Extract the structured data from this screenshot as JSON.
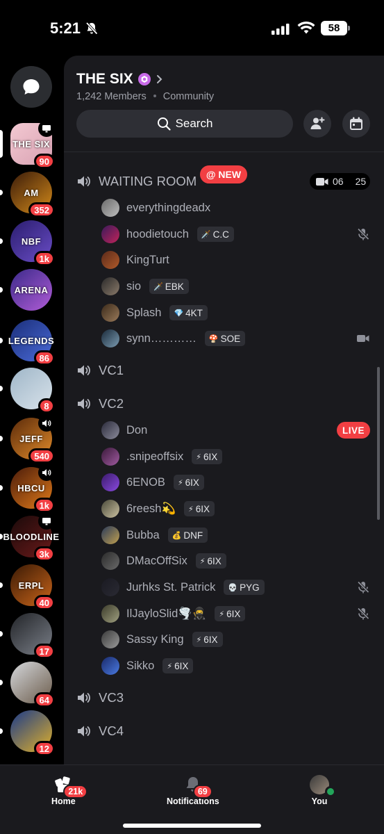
{
  "status_bar": {
    "time": "5:21",
    "battery": "58"
  },
  "rail": {
    "servers": [
      {
        "name": "the-six",
        "label": "THE SIX",
        "badge": "90",
        "colors": [
          "#f3c9d2",
          "#d9a2b3"
        ],
        "corner": "screen",
        "selected": true
      },
      {
        "name": "arboit-madden",
        "label": "AM",
        "badge": "352",
        "colors": [
          "#3a1b0a",
          "#d38a1a"
        ]
      },
      {
        "name": "nbf-league",
        "label": "NBF",
        "badge": "1k",
        "colors": [
          "#2a1d6e",
          "#6a4dc6"
        ]
      },
      {
        "name": "arena",
        "label": "ARENA",
        "badge": "",
        "colors": [
          "#3b2a8a",
          "#b05cd6"
        ]
      },
      {
        "name": "legends",
        "label": "LEGENDS",
        "badge": "86",
        "colors": [
          "#1b2f7a",
          "#4a6ad8"
        ]
      },
      {
        "name": "cartoon-server",
        "label": "",
        "badge": "8",
        "colors": [
          "#9fb6c8",
          "#d8e2ea"
        ]
      },
      {
        "name": "jeff-chat",
        "label": "JEFF",
        "badge": "540",
        "colors": [
          "#5a2a0a",
          "#e08a2a"
        ],
        "corner": "speaker"
      },
      {
        "name": "aur-hbcu",
        "label": "HBCU",
        "badge": "1k",
        "colors": [
          "#4a1b0a",
          "#e07a1a"
        ],
        "corner": "speaker"
      },
      {
        "name": "bloodline",
        "label": "BLOODLINE",
        "badge": "3k",
        "colors": [
          "#1a0a0a",
          "#6a1a1a"
        ],
        "corner": "screen"
      },
      {
        "name": "erpl",
        "label": "ERPL",
        "badge": "40",
        "colors": [
          "#3a1a05",
          "#c8641a"
        ]
      },
      {
        "name": "photo-server",
        "label": "",
        "badge": "17",
        "colors": [
          "#222428",
          "#7a7f88"
        ]
      },
      {
        "name": "selfie-server",
        "label": "",
        "badge": "64",
        "colors": [
          "#d5d8dc",
          "#6b5b4a"
        ]
      },
      {
        "name": "blue-server",
        "label": "",
        "badge": "12",
        "colors": [
          "#1a3a8a",
          "#e0b02a"
        ]
      }
    ]
  },
  "server": {
    "name": "THE SIX",
    "members": "1,242 Members",
    "type": "Community",
    "search_label": "Search"
  },
  "channels": {
    "waiting_room": {
      "name": "WAITING ROOM",
      "new_label": "@ NEW",
      "video_count": "06",
      "user_count": "25",
      "users": [
        {
          "name": "everythingdeadx",
          "tag": "",
          "tag_icon": "",
          "right": "",
          "avatar": [
            "#6b6b6b",
            "#bdbdbd"
          ]
        },
        {
          "name": "hoodietouch",
          "tag": "C.C",
          "tag_icon": "🗡️",
          "right": "mic-off",
          "avatar": [
            "#3a1a5a",
            "#c0245a"
          ]
        },
        {
          "name": "KingTurt",
          "tag": "",
          "tag_icon": "",
          "right": "",
          "avatar": [
            "#5a2a1a",
            "#b05a2a"
          ]
        },
        {
          "name": "sio",
          "tag": "EBK",
          "tag_icon": "🗡️",
          "right": "",
          "avatar": [
            "#2a2a2a",
            "#8a7a6a"
          ]
        },
        {
          "name": "Splash",
          "tag": "4KT",
          "tag_icon": "💎",
          "right": "",
          "avatar": [
            "#3a2a1a",
            "#9a7a5a"
          ]
        },
        {
          "name": "synn…………",
          "tag": "SOE",
          "tag_icon": "🍄",
          "right": "video",
          "avatar": [
            "#1a2a3a",
            "#7a9ab0"
          ]
        }
      ]
    },
    "vc1": {
      "name": "VC1"
    },
    "vc2": {
      "name": "VC2",
      "live_label": "LIVE",
      "users": [
        {
          "name": "Don",
          "tag": "",
          "tag_icon": "",
          "right": "live",
          "avatar": [
            "#2a2a3a",
            "#8a8a9a"
          ]
        },
        {
          "name": ".snipeoffsix",
          "tag": "6IX",
          "tag_icon": "⚡",
          "right": "",
          "avatar": [
            "#3a1a3a",
            "#a05aa0"
          ]
        },
        {
          "name": "6ENOB",
          "tag": "6IX",
          "tag_icon": "⚡",
          "right": "",
          "avatar": [
            "#3a1a6a",
            "#8a4ae0"
          ]
        },
        {
          "name": "6reesh💫",
          "tag": "6IX",
          "tag_icon": "⚡",
          "right": "",
          "avatar": [
            "#4a4a3a",
            "#cac0a0"
          ]
        },
        {
          "name": "Bubba",
          "tag": "DNF",
          "tag_icon": "💰",
          "right": "",
          "avatar": [
            "#2a3a5a",
            "#c0a050"
          ]
        },
        {
          "name": "DMacOffSix",
          "tag": "6IX",
          "tag_icon": "⚡",
          "right": "",
          "avatar": [
            "#2a2a2a",
            "#6a6a6a"
          ]
        },
        {
          "name": "Jurhks St. Patrick",
          "tag": "PYG",
          "tag_icon": "💀",
          "right": "mic-off",
          "avatar": [
            "#1a1a22",
            "#2a2a33"
          ]
        },
        {
          "name": "IlJayloSlid🌪️🥷",
          "tag": "6IX",
          "tag_icon": "⚡",
          "right": "mic-off",
          "avatar": [
            "#3a3a2a",
            "#a0a080"
          ]
        },
        {
          "name": "Sassy King",
          "tag": "6IX",
          "tag_icon": "⚡",
          "right": "",
          "avatar": [
            "#3a3a3a",
            "#9a9a9a"
          ]
        },
        {
          "name": "Sikko",
          "tag": "6IX",
          "tag_icon": "⚡",
          "right": "",
          "avatar": [
            "#1a2a6a",
            "#4a7ae0"
          ]
        }
      ]
    },
    "vc3": {
      "name": "VC3"
    },
    "vc4": {
      "name": "VC4"
    }
  },
  "tabbar": {
    "home": {
      "label": "Home",
      "badge": "21k"
    },
    "notifications": {
      "label": "Notifications",
      "badge": "69"
    },
    "you": {
      "label": "You"
    }
  },
  "colors": {
    "accent_red": "#f23f43",
    "online_green": "#23a55a",
    "panel": "#1a1a1e"
  }
}
